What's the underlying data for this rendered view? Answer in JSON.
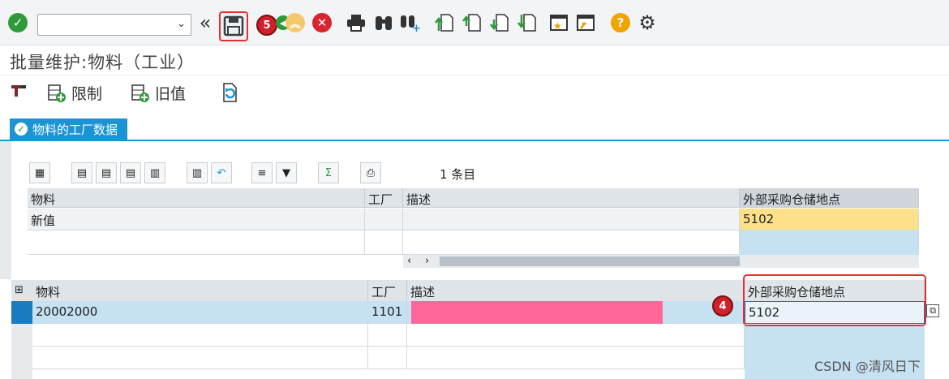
{
  "toolbar": {
    "command_field_value": "",
    "save_badge": "5",
    "icons": [
      "enter-icon",
      "back-icon",
      "save-icon",
      "exit-icon",
      "up-icon",
      "cancel-icon",
      "print-icon",
      "find-icon",
      "find-next-icon",
      "first-page-icon",
      "prev-page-icon",
      "next-page-icon",
      "last-page-icon",
      "new-session-icon",
      "shortcut-icon",
      "help-icon",
      "settings-icon"
    ]
  },
  "page_title": "批量维护:物料（工业）",
  "app_toolbar": {
    "restrict_label": "限制",
    "old_value_label": "旧值"
  },
  "tab": {
    "label": "物料的工厂数据"
  },
  "alv": {
    "row_count": "1 条目"
  },
  "upper_table": {
    "columns": [
      "物料",
      "工厂",
      "描述",
      "外部采购仓储地点"
    ],
    "new_value_row": {
      "label": "新值",
      "plant": "",
      "description": "",
      "storage_location": "5102"
    }
  },
  "lower_table": {
    "columns": [
      "物料",
      "工厂",
      "描述",
      "外部采购仓储地点"
    ],
    "rows": [
      {
        "material": "20002000",
        "plant": "1101",
        "description": "",
        "storage_location": "5102"
      }
    ],
    "field_badge": "4"
  },
  "watermark": "CSDN @清风日下",
  "colors": {
    "tab_blue": "#1b94d6",
    "highlight_red": "#e03030",
    "new_value_yellow": "#fde08a",
    "selected_row_blue": "#c6e1f1",
    "redaction_pink": "#ff6699"
  }
}
